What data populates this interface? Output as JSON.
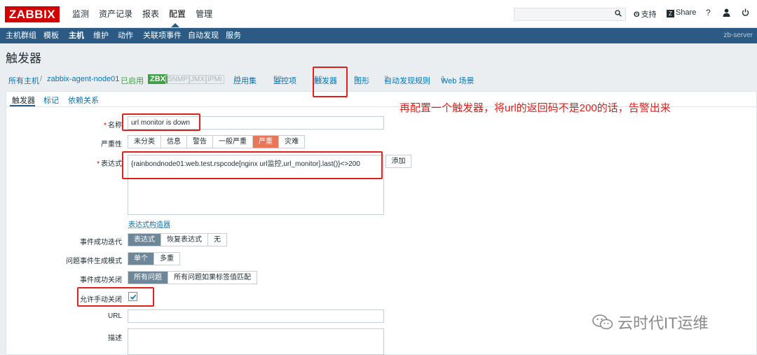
{
  "header": {
    "logo": "ZABBIX",
    "menu": [
      "监测",
      "资产记录",
      "报表",
      "配置",
      "管理"
    ],
    "support": "支持",
    "share": "Share",
    "help": "?",
    "icons": [
      "search-icon",
      "support-icon",
      "share-icon",
      "help-icon",
      "user-icon",
      "power-icon"
    ]
  },
  "subnav": {
    "items": [
      "主机群组",
      "模板",
      "主机",
      "维护",
      "动作",
      "关联项事件",
      "自动发现",
      "服务"
    ],
    "server": "zb-server"
  },
  "page": {
    "title": "触发器"
  },
  "breadcrumb": {
    "all_hosts": "所有主机",
    "sep": "/",
    "host": "zabbix-agent-node01",
    "status": "已启用",
    "zbx": "ZBX",
    "snmp": "SNMP",
    "jmx": "JMX",
    "ipmi": "IPMI",
    "apps": "应用集",
    "apps_count": "11",
    "items": "监控项",
    "items_count": "52",
    "triggers": "触发器",
    "triggers_count": "22",
    "graphs": "图形",
    "graphs_count": "9",
    "discovery": "自动发现规则",
    "discovery_count": "2",
    "web": "Web 场景",
    "web_count": "1"
  },
  "tabs": [
    "触发器",
    "标记",
    "依赖关系"
  ],
  "form": {
    "name_label": "名称",
    "name_value": "url monitor is down",
    "severity_label": "严重性",
    "severity_options": [
      "未分类",
      "信息",
      "警告",
      "一般严重",
      "严重",
      "灾难"
    ],
    "severity_selected": "严重",
    "expression_label": "表达式",
    "expression_value": "{rainbondnode01:web.test.rspcode[nginx url监控,url_monitor].last()}<>200",
    "add_button": "添加",
    "expression_builder": "表达式构造器",
    "ok_event_label": "事件成功迭代",
    "ok_event_options": [
      "表达式",
      "恢复表达式",
      "无"
    ],
    "problem_mode_label": "问题事件生成模式",
    "problem_mode_options": [
      "单个",
      "多重"
    ],
    "ok_close_label": "事件成功关闭",
    "ok_close_options": [
      "所有问题",
      "所有问题如果标签值匹配"
    ],
    "manual_close_label": "允许手动关闭",
    "manual_close_checked": true,
    "url_label": "URL",
    "url_value": "",
    "desc_label": "描述",
    "desc_value": ""
  },
  "annotation": {
    "note": "再配置一个触发器，将url的返回码不是200的话，告警出来",
    "color": "#e0201b"
  },
  "watermark": {
    "text": "云时代IT运维"
  }
}
